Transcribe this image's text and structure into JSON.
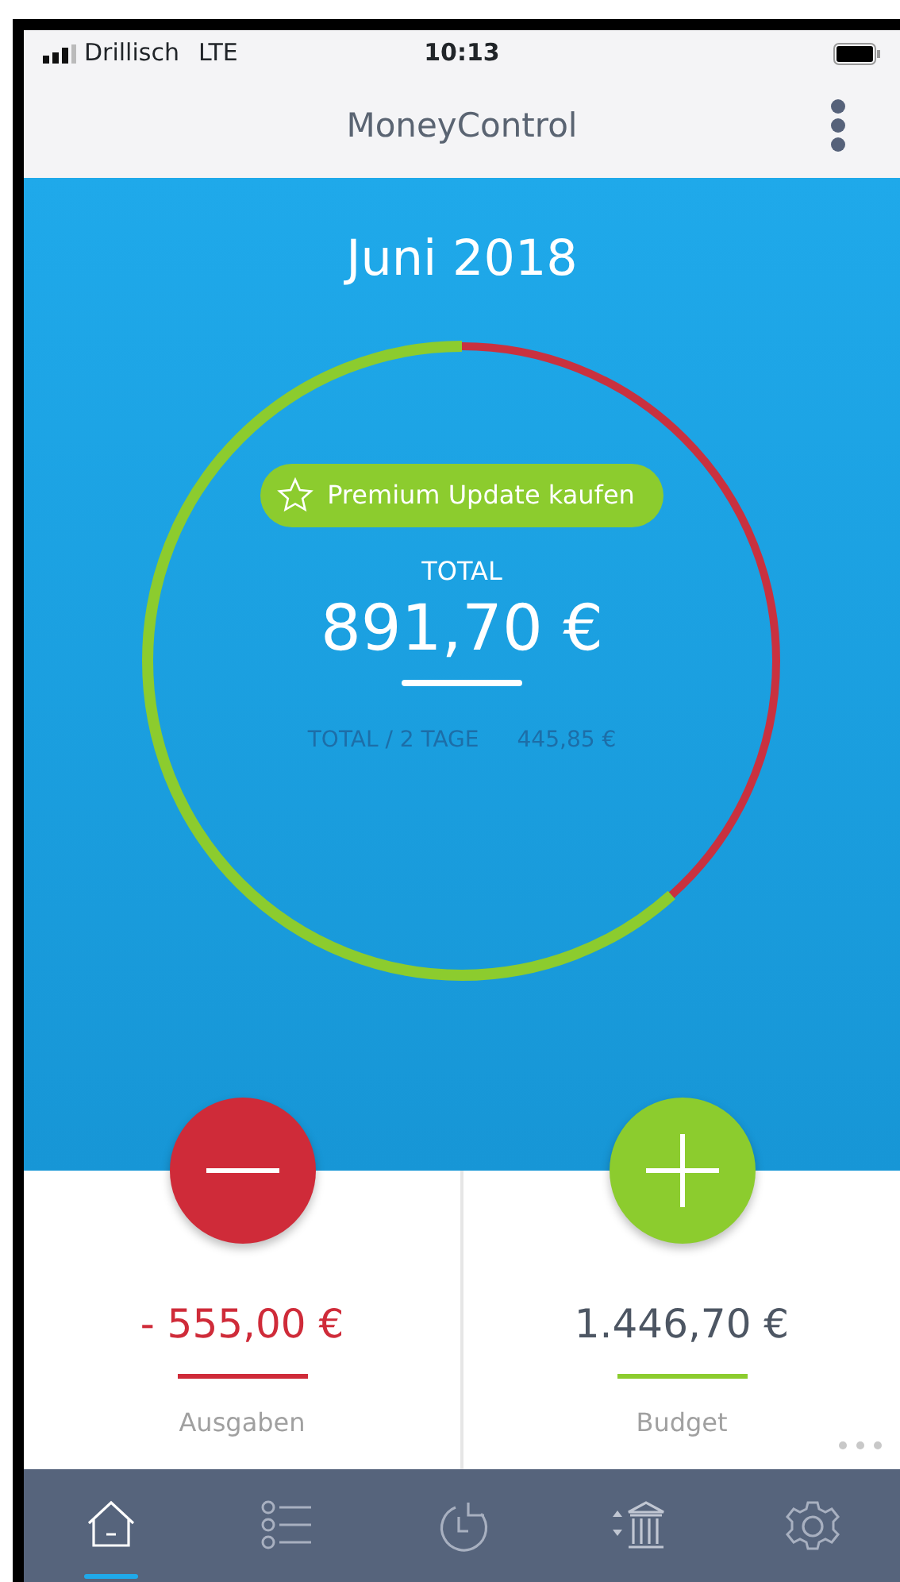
{
  "status_bar": {
    "carrier": "Drillisch",
    "network": "LTE",
    "time": "10:13"
  },
  "nav_bar": {
    "title": "MoneyControl"
  },
  "summary": {
    "month": "Juni 2018",
    "level": 0.616,
    "premium_button": "Premium Update kaufen",
    "total_label": "TOTAL",
    "total_value": "891,70 €",
    "per_day_label": "TOTAL / 2 TAGE",
    "per_day_value": "445,85 €"
  },
  "cards": [
    {
      "kind": "expense",
      "amount": "- 555,00 €",
      "label": "Ausgaben"
    },
    {
      "kind": "budget",
      "amount": "1.446,70 €",
      "label": "Budget"
    }
  ],
  "tabs": [
    {
      "selected": true
    },
    {
      "selected": false
    },
    {
      "selected": false
    },
    {
      "selected": false
    },
    {
      "selected": false
    }
  ]
}
